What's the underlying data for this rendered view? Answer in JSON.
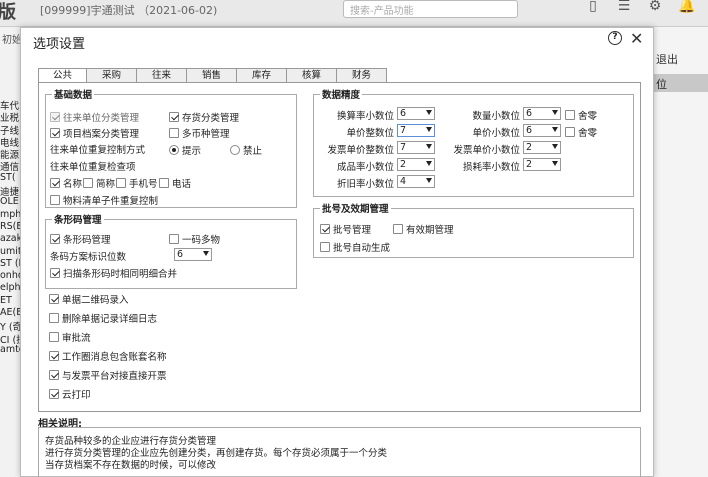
{
  "topbar": {
    "brand": "版",
    "account": "[099999]宇通测试 （2021-06-02)",
    "search_placeholder": "搜索-产品功能"
  },
  "background": {
    "tab": "初始",
    "left_rows": [
      "车代",
      "业税",
      "子线",
      "电线",
      "能源",
      "通信",
      "ST(",
      "迪捷",
      "OLE",
      "mphe",
      "RS(E",
      "azaki",
      "umito",
      "ST (E",
      "onho",
      "elphi",
      "ET",
      "AE(E",
      "Y (奇",
      "CI (拉",
      "amtec"
    ],
    "exit": "退出",
    "col_header": "位"
  },
  "dialog": {
    "title": "选项设置",
    "help_icon": "?",
    "close_icon": "✕"
  },
  "tabs": [
    "公共",
    "采购",
    "往来",
    "销售",
    "库存",
    "核算",
    "财务"
  ],
  "basic": {
    "title": "基础数据",
    "row1": [
      {
        "label": "往来单位分类管理",
        "checked": true,
        "disabled": true
      },
      {
        "label": "存货分类管理",
        "checked": true,
        "disabled": false
      }
    ],
    "row2": [
      {
        "label": "项目档案分类管理",
        "checked": true,
        "disabled": false
      },
      {
        "label": "多币种管理",
        "checked": false,
        "disabled": false
      }
    ],
    "dup_ctrl_label": "往来单位重复控制方式",
    "radio_prompt": "提示",
    "radio_forbid": "禁止",
    "dup_check_label": "往来单位重复检查项",
    "checks": [
      {
        "label": "名称",
        "checked": true
      },
      {
        "label": "简称",
        "checked": false
      },
      {
        "label": "手机号",
        "checked": false
      },
      {
        "label": "电话",
        "checked": false
      }
    ],
    "material": {
      "label": "物料清单子件重复控制",
      "checked": false
    }
  },
  "barcode": {
    "title": "条形码管理",
    "mgmt": {
      "label": "条形码管理",
      "checked": true
    },
    "one_multi": {
      "label": "一码多物",
      "checked": false
    },
    "id_digits_label": "条码方案标识位数",
    "id_digits_value": "6",
    "merge": {
      "label": "扫描条形码时相同明细合并",
      "checked": true
    }
  },
  "options": [
    {
      "label": "单据二维码录入",
      "checked": true
    },
    {
      "label": "删除单据记录详细日志",
      "checked": false
    },
    {
      "label": "审批流",
      "checked": false
    },
    {
      "label": "工作圈消息包含账套名称",
      "checked": true
    },
    {
      "label": "与发票平台对接直接开票",
      "checked": true
    },
    {
      "label": "云打印",
      "checked": true
    }
  ],
  "precision": {
    "title": "数据精度",
    "left": [
      {
        "label": "换算率小数位",
        "value": "6"
      },
      {
        "label": "单价整数位",
        "value": "7"
      },
      {
        "label": "发票单价整数位",
        "value": "7"
      },
      {
        "label": "成品率小数位",
        "value": "2"
      },
      {
        "label": "折旧率小数位",
        "value": "4"
      }
    ],
    "right": [
      {
        "label": "数量小数位",
        "value": "6"
      },
      {
        "label": "单价小数位",
        "value": "6"
      },
      {
        "label": "发票单价小数位",
        "value": "2"
      },
      {
        "label": "损耗率小数位",
        "value": "2"
      }
    ],
    "round1": {
      "label": "舍零",
      "checked": false
    },
    "round2": {
      "label": "舍零",
      "checked": false
    }
  },
  "batch": {
    "title": "批号及效期管理",
    "batch_mgmt": {
      "label": "批号管理",
      "checked": true
    },
    "expiry": {
      "label": "有效期管理",
      "checked": false
    },
    "auto": {
      "label": "批号自动生成",
      "checked": false
    }
  },
  "notes": {
    "title": "相关说明:",
    "lines": [
      "存货品种较多的企业应进行存货分类管理",
      "进行存货分类管理的企业应先创建分类，再创建存货。每个存货必须属于一个分类",
      "当存货档案不存在数据的时候，可以修改"
    ]
  }
}
